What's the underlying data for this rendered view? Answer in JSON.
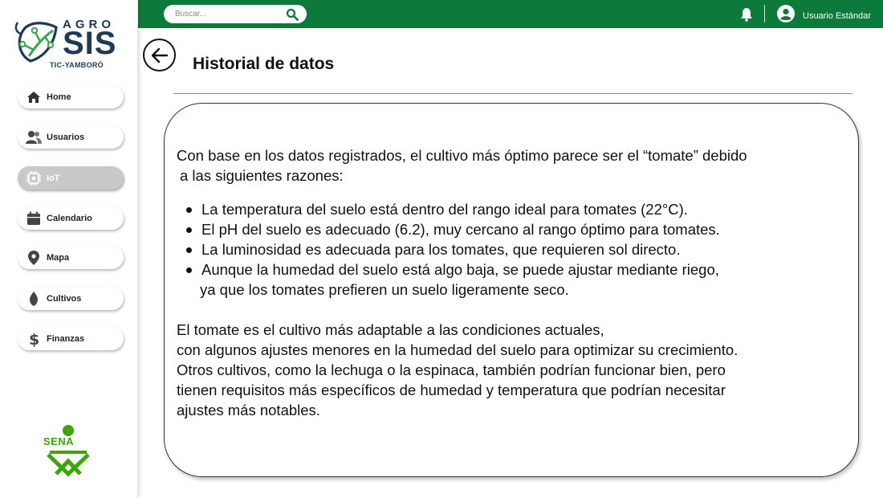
{
  "brand": {
    "top_word": "AGRO",
    "main_word": "SIS",
    "subtitle": "TIC-YAMBORÓ",
    "footer_logo": "SENA"
  },
  "sidebar": {
    "items": [
      {
        "label": "Home",
        "icon": "home-icon",
        "active": false
      },
      {
        "label": "Usuarios",
        "icon": "users-icon",
        "active": false
      },
      {
        "label": "IoT",
        "icon": "chip-icon",
        "active": true
      },
      {
        "label": "Calendario",
        "icon": "calendar-icon",
        "active": false
      },
      {
        "label": "Mapa",
        "icon": "map-pin-icon",
        "active": false
      },
      {
        "label": "Cultivos",
        "icon": "leaf-icon",
        "active": false
      },
      {
        "label": "Finanzas",
        "icon": "dollar-icon",
        "active": false
      }
    ]
  },
  "topbar": {
    "search_placeholder": "Buscar...",
    "user_name": "Usuario Estándar"
  },
  "page": {
    "title": "Historial de datos"
  },
  "content": {
    "intro_line1": "Con base en los datos registrados, el cultivo más óptimo parece ser el “tomate” debido",
    "intro_line2": "a las siguientes razones:",
    "bullets": [
      "La temperatura del suelo está dentro del rango ideal para tomates (22°C).",
      "El pH del suelo es adecuado (6.2), muy cercano al rango óptimo para tomates.",
      "La luminosidad es adecuada para los tomates, que requieren sol directo.",
      "Aunque la humedad del suelo está algo baja, se puede ajustar mediante riego,"
    ],
    "bullet_continuation": "ya que los tomates prefieren un suelo ligeramente seco.",
    "conclusion": [
      "El tomate es el cultivo más adaptable a las condiciones actuales,",
      "con algunos ajustes menores en la humedad del suelo para optimizar su crecimiento.",
      "Otros cultivos, como la lechuga o la espinaca, también podrían funcionar bien, pero",
      "tienen requisitos más específicos de humedad y temperatura que podrían necesitar",
      "ajustes más notables."
    ]
  },
  "colors": {
    "primary_green": "#0b7a3b",
    "brand_navy": "#1d3a57",
    "sena_green": "#39a900",
    "active_nav": "#c9c9c9"
  }
}
